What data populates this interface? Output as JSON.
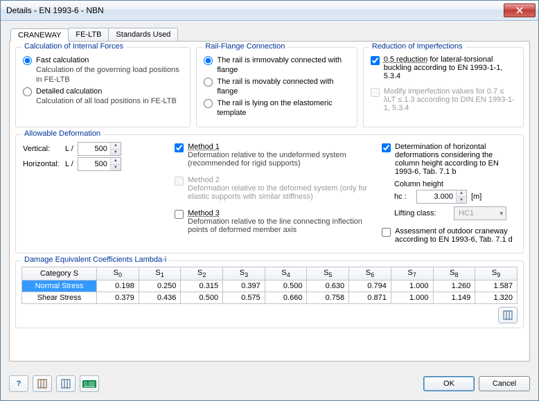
{
  "title": "Details - EN 1993-6 - NBN",
  "tabs": [
    "CRANEWAY",
    "FE-LTB",
    "Standards Used"
  ],
  "calc_forces": {
    "title": "Calculation of Internal Forces",
    "opt1_title": "Fast calculation",
    "opt1_sub": "Calculation of the governing load positions in FE-LTB",
    "opt2_title": "Detailed calculation",
    "opt2_sub": "Calculation of all load positions in FE-LTB"
  },
  "rail": {
    "title": "Rail-Flange Connection",
    "opt1": "The rail is immovably connected with flange",
    "opt2": "The rail is movably connected with flange",
    "opt3": "The rail is lying on the elastomeric template"
  },
  "reduction": {
    "title": "Reduction of Imperfections",
    "chk1_a": "0.5 reduction",
    "chk1_b": " for lateral-torsional buckling according to EN 1993-1-1, 5.3.4",
    "chk2": "Modify imperfection values for 0.7 ≤ λLT ≤ 1.3 according to DIN EN 1993-1-1, 5.3.4"
  },
  "def": {
    "title": "Allowable Deformation",
    "vertical": "Vertical:",
    "horizontal": "Horizontal:",
    "lover": "L /",
    "v_val": "500",
    "h_val": "500",
    "m1": "Method 1",
    "m1_sub": "Deformation relative to the undeformed system (recommended for rigid supports)",
    "m2": "Method 2",
    "m2_sub": "Deformation relative to the deformed system (only for elastic supports with similar stiffness)",
    "m3": "Method 3",
    "m3_sub": "Deformation relative to the line connecting inflection points of deformed member axis",
    "horiz_det": "Determination of horizontal deformations considering the column height according to EN 1993-6, Tab. 7.1 b",
    "col_h": "Column height",
    "hc": "hc :",
    "hc_val": "3.000",
    "hc_unit": "[m]",
    "lift": "Lifting class:",
    "lift_val": "HC1",
    "outdoor": "Assessment of outdoor craneway according to EN 1993-6, Tab. 7.1 d"
  },
  "lambda": {
    "title": "Damage Equivalent Coefficients Lambda-i",
    "headers": [
      "Category S",
      "S0",
      "S1",
      "S2",
      "S3",
      "S4",
      "S5",
      "S6",
      "S7",
      "S8",
      "S9"
    ],
    "rows": [
      {
        "name": "Normal Stress",
        "vals": [
          "0.198",
          "0.250",
          "0.315",
          "0.397",
          "0.500",
          "0.630",
          "0.794",
          "1.000",
          "1.260",
          "1.587"
        ]
      },
      {
        "name": "Shear Stress",
        "vals": [
          "0.379",
          "0.436",
          "0.500",
          "0.575",
          "0.660",
          "0.758",
          "0.871",
          "1.000",
          "1.149",
          "1.320"
        ]
      }
    ]
  },
  "buttons": {
    "ok": "OK",
    "cancel": "Cancel"
  }
}
